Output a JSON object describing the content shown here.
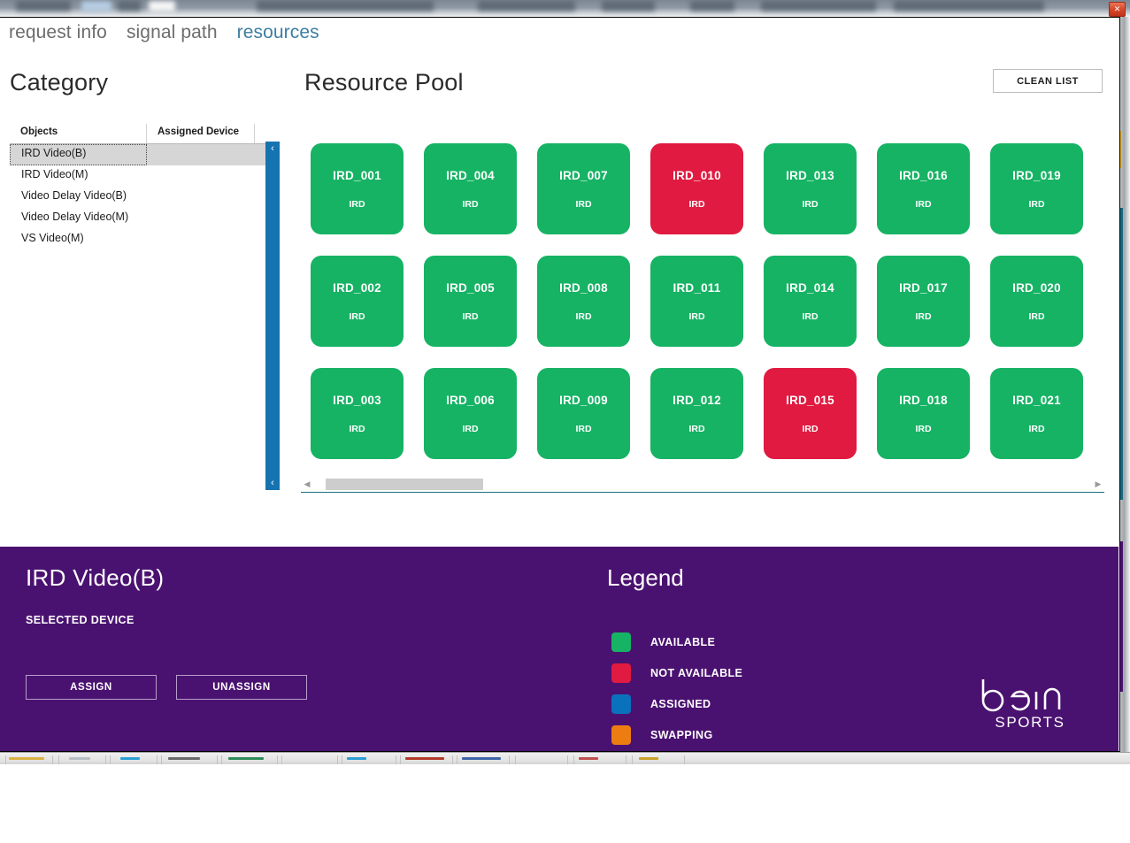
{
  "window": {
    "close_label": "✕"
  },
  "nav": {
    "tabs": [
      {
        "label": "request info",
        "active": false
      },
      {
        "label": "signal path",
        "active": false
      },
      {
        "label": "resources",
        "active": true
      }
    ]
  },
  "category": {
    "heading": "Category",
    "columns": [
      "Objects",
      "Assigned Device"
    ],
    "rows": [
      {
        "name": "IRD Video(B)",
        "assigned": "",
        "selected": true
      },
      {
        "name": "IRD Video(M)",
        "assigned": "",
        "selected": false
      },
      {
        "name": "Video Delay Video(B)",
        "assigned": "",
        "selected": false
      },
      {
        "name": "Video Delay Video(M)",
        "assigned": "",
        "selected": false
      },
      {
        "name": "VS Video(M)",
        "assigned": "",
        "selected": false
      }
    ],
    "collapse_chevron": "‹"
  },
  "pool": {
    "heading": "Resource Pool",
    "clean_list_label": "CLEAN LIST",
    "scroll_left_arrow": "◀",
    "scroll_right_arrow": "▶",
    "tiles": [
      {
        "name": "IRD_001",
        "type": "IRD",
        "status": "available"
      },
      {
        "name": "IRD_004",
        "type": "IRD",
        "status": "available"
      },
      {
        "name": "IRD_007",
        "type": "IRD",
        "status": "available"
      },
      {
        "name": "IRD_010",
        "type": "IRD",
        "status": "not_available"
      },
      {
        "name": "IRD_013",
        "type": "IRD",
        "status": "available"
      },
      {
        "name": "IRD_016",
        "type": "IRD",
        "status": "available"
      },
      {
        "name": "IRD_019",
        "type": "IRD",
        "status": "available"
      },
      {
        "name": "IRD_002",
        "type": "IRD",
        "status": "available"
      },
      {
        "name": "IRD_005",
        "type": "IRD",
        "status": "available"
      },
      {
        "name": "IRD_008",
        "type": "IRD",
        "status": "available"
      },
      {
        "name": "IRD_011",
        "type": "IRD",
        "status": "available"
      },
      {
        "name": "IRD_014",
        "type": "IRD",
        "status": "available"
      },
      {
        "name": "IRD_017",
        "type": "IRD",
        "status": "available"
      },
      {
        "name": "IRD_020",
        "type": "IRD",
        "status": "available"
      },
      {
        "name": "IRD_003",
        "type": "IRD",
        "status": "available"
      },
      {
        "name": "IRD_006",
        "type": "IRD",
        "status": "available"
      },
      {
        "name": "IRD_009",
        "type": "IRD",
        "status": "available"
      },
      {
        "name": "IRD_012",
        "type": "IRD",
        "status": "available"
      },
      {
        "name": "IRD_015",
        "type": "IRD",
        "status": "not_available"
      },
      {
        "name": "IRD_018",
        "type": "IRD",
        "status": "available"
      },
      {
        "name": "IRD_021",
        "type": "IRD",
        "status": "available"
      }
    ]
  },
  "detail": {
    "device_title": "IRD Video(B)",
    "selected_device_label": "SELECTED DEVICE",
    "assign_label": "ASSIGN",
    "unassign_label": "UNASSIGN"
  },
  "legend": {
    "title": "Legend",
    "items": [
      {
        "label": "AVAILABLE",
        "color": "#16b364"
      },
      {
        "label": "NOT AVAILABLE",
        "color": "#e01a40"
      },
      {
        "label": "ASSIGNED",
        "color": "#0a72bd"
      },
      {
        "label": "SWAPPING",
        "color": "#ed7d11"
      }
    ]
  },
  "branding": {
    "logo_primary": "beIN",
    "logo_secondary": "SPORTS"
  },
  "colors": {
    "available": "#16b364",
    "not_available": "#e01a40",
    "assigned": "#0a72bd",
    "swapping": "#ed7d11",
    "panel_purple": "#4a1270",
    "splitter_blue": "#1573b0",
    "active_tab": "#3e7da2"
  }
}
